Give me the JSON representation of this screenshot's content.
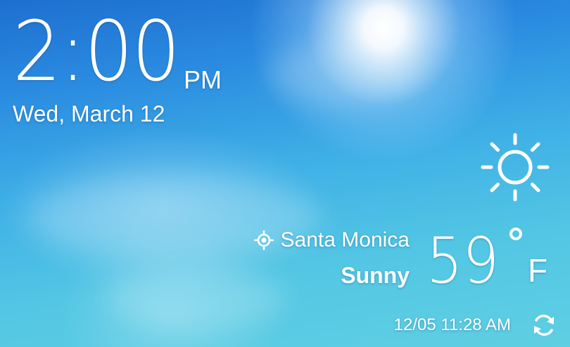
{
  "clock": {
    "time": "2:00",
    "ampm": "PM",
    "date": "Wed, March 12"
  },
  "weather": {
    "icon": "sun-icon",
    "location": "Santa Monica",
    "location_icon": "location-target-icon",
    "condition": "Sunny",
    "temperature": "59",
    "unit": "F",
    "updated": "12/05 11:28 AM",
    "refresh_icon": "refresh-icon"
  },
  "colors": {
    "sky_top": "#1e6fd0",
    "sky_bottom": "#5fcfe2",
    "text": "#ffffff"
  }
}
